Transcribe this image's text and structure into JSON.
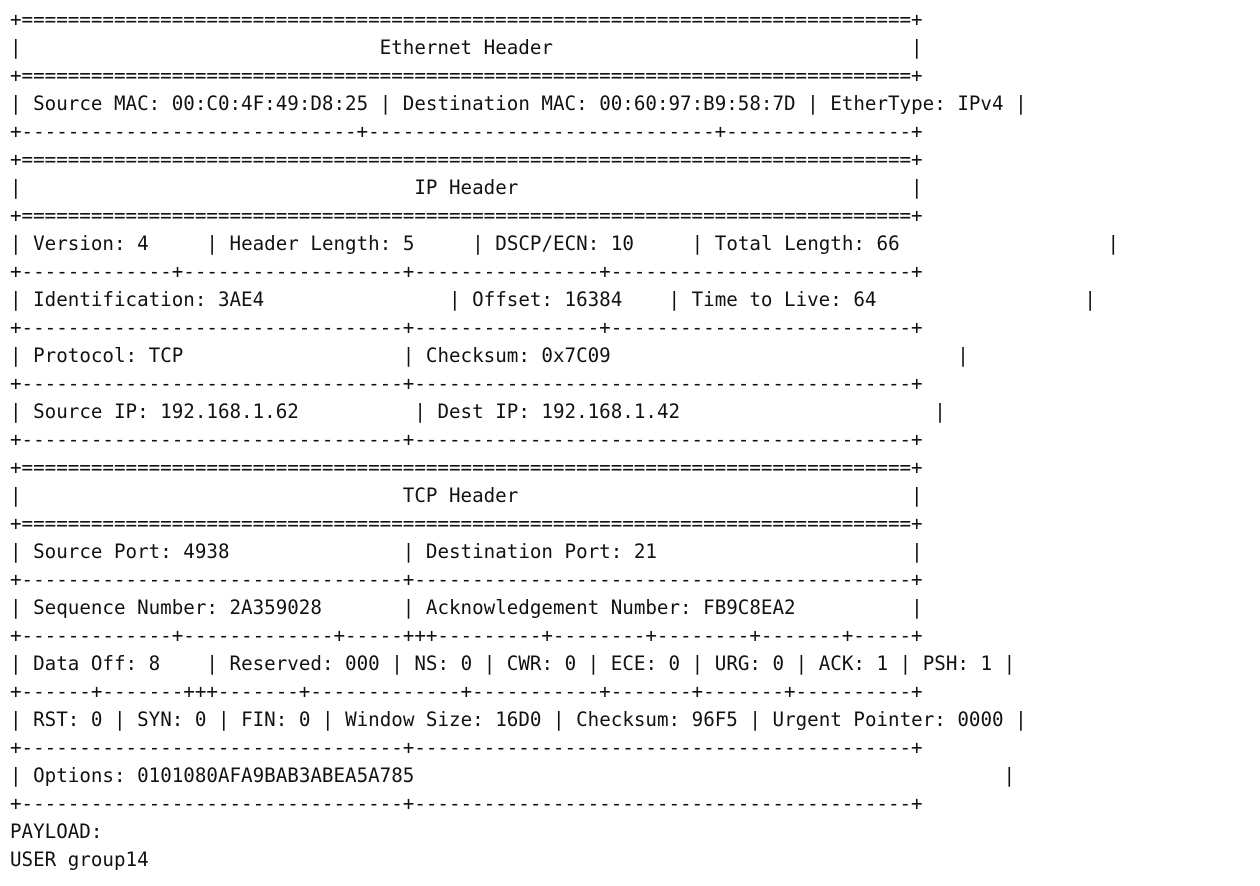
{
  "ethernet": {
    "title": "Ethernet Header",
    "source_mac_label": "Source MAC",
    "source_mac": "00:C0:4F:49:D8:25",
    "dest_mac_label": "Destination MAC",
    "dest_mac": "00:60:97:B9:58:7D",
    "ethertype_label": "EtherType",
    "ethertype": "IPv4"
  },
  "ip": {
    "title": "IP Header",
    "version_label": "Version",
    "version": "4",
    "header_length_label": "Header Length",
    "header_length": "5",
    "dscp_ecn_label": "DSCP/ECN",
    "dscp_ecn": "10",
    "total_length_label": "Total Length",
    "total_length": "66",
    "identification_label": "Identification",
    "identification": "3AE4",
    "offset_label": "Offset",
    "offset": "16384",
    "ttl_label": "Time to Live",
    "ttl": "64",
    "protocol_label": "Protocol",
    "protocol": "TCP",
    "checksum_label": "Checksum",
    "checksum": "0x7C09",
    "source_ip_label": "Source IP",
    "source_ip": "192.168.1.62",
    "dest_ip_label": "Dest IP",
    "dest_ip": "192.168.1.42"
  },
  "tcp": {
    "title": "TCP Header",
    "source_port_label": "Source Port",
    "source_port": "4938",
    "dest_port_label": "Destination Port",
    "dest_port": "21",
    "seq_label": "Sequence Number",
    "seq": "2A359028",
    "ack_num_label": "Acknowledgement Number",
    "ack_num": "FB9C8EA2",
    "data_off_label": "Data Off",
    "data_off": "8",
    "reserved_label": "Reserved",
    "reserved": "000",
    "ns_label": "NS",
    "ns": "0",
    "cwr_label": "CWR",
    "cwr": "0",
    "ece_label": "ECE",
    "ece": "0",
    "urg_label": "URG",
    "urg": "0",
    "ack_label": "ACK",
    "ack": "1",
    "psh_label": "PSH",
    "psh": "1",
    "rst_label": "RST",
    "rst": "0",
    "syn_label": "SYN",
    "syn": "0",
    "fin_label": "FIN",
    "fin": "0",
    "window_label": "Window Size",
    "window": "16D0",
    "checksum_label": "Checksum",
    "checksum": "96F5",
    "urgent_label": "Urgent Pointer",
    "urgent": "0000",
    "options_label": "Options",
    "options": "0101080AFA9BAB3ABEA5A785"
  },
  "payload": {
    "label": "PAYLOAD:",
    "content": "USER group14"
  }
}
